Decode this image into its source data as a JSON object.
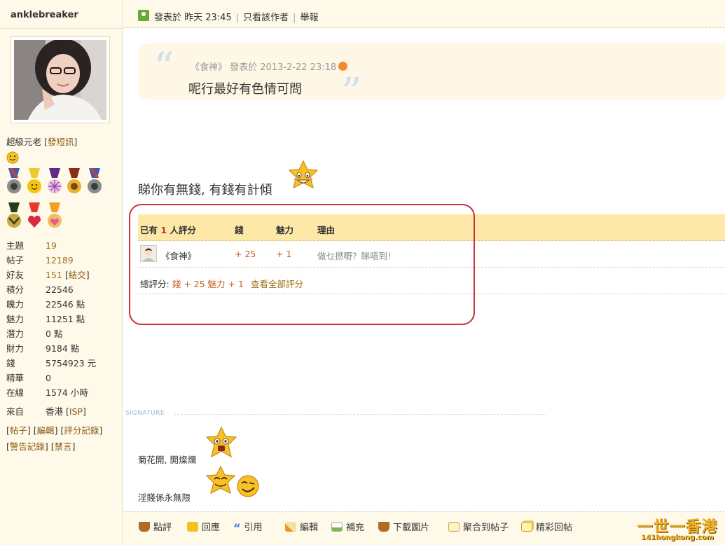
{
  "sidebar": {
    "username": "anklebreaker",
    "rank": "超級元老",
    "pm_link": "發短訊",
    "stats": [
      {
        "label": "主題",
        "value": "19",
        "link": true
      },
      {
        "label": "帖子",
        "value": "12189",
        "link": true
      },
      {
        "label": "好友",
        "value": "151",
        "link": true,
        "extra": "結交"
      },
      {
        "label": "積分",
        "value": "22546"
      },
      {
        "label": "魄力",
        "value": "22546 點"
      },
      {
        "label": "魅力",
        "value": "11251 點"
      },
      {
        "label": "潛力",
        "value": "0 點"
      },
      {
        "label": "財力",
        "value": "9184 點"
      },
      {
        "label": "錢",
        "value": "5754923 元"
      },
      {
        "label": "精華",
        "value": "0"
      },
      {
        "label": "在線",
        "value": "1574 小時"
      }
    ],
    "from_label": "來自",
    "from_value": "香港",
    "from_isp": "ISP",
    "links_row1": [
      "帖子",
      "編輯",
      "評分記錄"
    ],
    "links_row2": [
      "警告記錄",
      "禁言"
    ]
  },
  "post": {
    "meta_posted": "發表於 昨天 23:45",
    "meta_author_only": "只看該作者",
    "meta_report": "舉報",
    "quote_author": "《食神》 發表於 2013-2-22 23:18",
    "quote_text": "呢行最好有色情可問",
    "body_text": "睇你有無錢, 有錢有計傾"
  },
  "rating": {
    "header_prefix": "已有",
    "header_count": "1",
    "header_suffix": "人評分",
    "col_money": "錢",
    "col_charm": "魅力",
    "col_reason": "理由",
    "rater_name": "《食神》",
    "rater_money": "+ 25",
    "rater_charm": "+ 1",
    "rater_reason": "做乜撚嘢？睇唔到！",
    "total_label": "總評分:",
    "total_money_label": "錢",
    "total_money": "+ 25",
    "total_charm_label": "魅力",
    "total_charm": "+ 1",
    "view_all": "查看全部評分"
  },
  "signature": {
    "label": "SIGNATURE",
    "line1": "菊花開, 開燦爛",
    "line2": "淫賤係永無限"
  },
  "toolbar": {
    "items": [
      "點評",
      "回應",
      "引用",
      "編輯",
      "補充",
      "下載圖片",
      "聚合到帖子",
      "精彩回帖"
    ]
  },
  "logo": {
    "main": "一世一香港",
    "sub": "141hongkong.com"
  },
  "colors": {
    "accent_gold": "#a0731a",
    "rating_orange": "#c2601f",
    "sidebar_bg": "#fef9e9",
    "rating_header_bg": "#fde8a8",
    "highlight_ring": "#c9303a"
  }
}
